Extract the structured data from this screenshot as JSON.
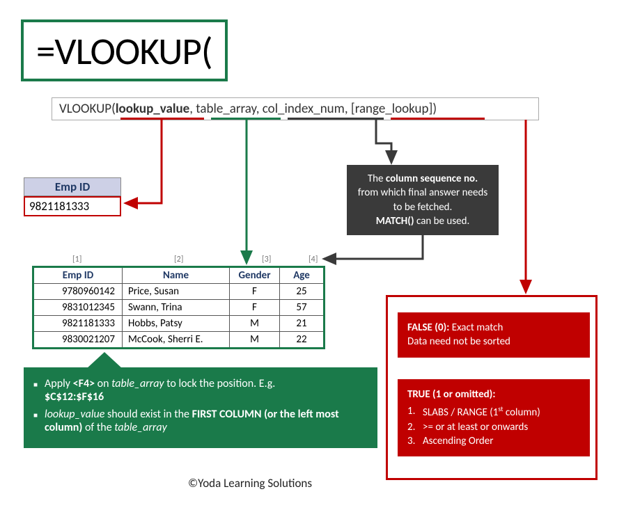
{
  "formula": "=VLOOKUP(",
  "syntax": {
    "fn": "VLOOKUP(",
    "p1": "lookup_value",
    "sep": ", ",
    "p2": "table_array",
    "p3": "col_index_num",
    "p4": "[range_lookup]",
    "close": ")"
  },
  "lookup": {
    "header": "Emp ID",
    "value": "9821181333"
  },
  "coltags": {
    "c1": "[1]",
    "c2": "[2]",
    "c3": "[3]",
    "c4": "[4]"
  },
  "table": {
    "headers": {
      "id": "Emp ID",
      "name": "Name",
      "gender": "Gender",
      "age": "Age"
    },
    "rows": [
      {
        "id": "9780960142",
        "name": "Price, Susan",
        "gender": "F",
        "age": "25"
      },
      {
        "id": "9831012345",
        "name": "Swann, Trina",
        "gender": "F",
        "age": "57"
      },
      {
        "id": "9821181333",
        "name": "Hobbs, Patsy",
        "gender": "M",
        "age": "21"
      },
      {
        "id": "9830021207",
        "name": "McCook, Sherri E.",
        "gender": "M",
        "age": "22"
      }
    ]
  },
  "greenTips": {
    "l1a": "Apply ",
    "l1b": "<F4>",
    "l1c": " on ",
    "l1d": "table_array",
    "l1e": " to lock the position. E.g. ",
    "l1f": "$C$12:$F$16",
    "l2a": "lookup_value",
    "l2b": " should exist in the ",
    "l2c": "FIRST COLUMN (or the left most column)",
    "l2d": " of the ",
    "l2e": "table_array"
  },
  "darkBox": {
    "l1a": "The ",
    "l1b": "column sequence no.",
    "l2": "from which final answer needs to be fetched.",
    "l3a": "MATCH()",
    "l3b": " can be used."
  },
  "redBoxA": {
    "h": "FALSE (0):",
    "h2": " Exact match",
    "l2": "Data need not be sorted"
  },
  "redBoxB": {
    "h": "TRUE (1 or omitted):",
    "i1": "1.",
    "t1a": "SLABS / RANGE (1",
    "t1b": "st",
    "t1c": " column)",
    "i2": "2.",
    "t2": ">= or at least or onwards",
    "i3": "3.",
    "t3": "Ascending Order"
  },
  "copyright": "©Yoda Learning Solutions"
}
